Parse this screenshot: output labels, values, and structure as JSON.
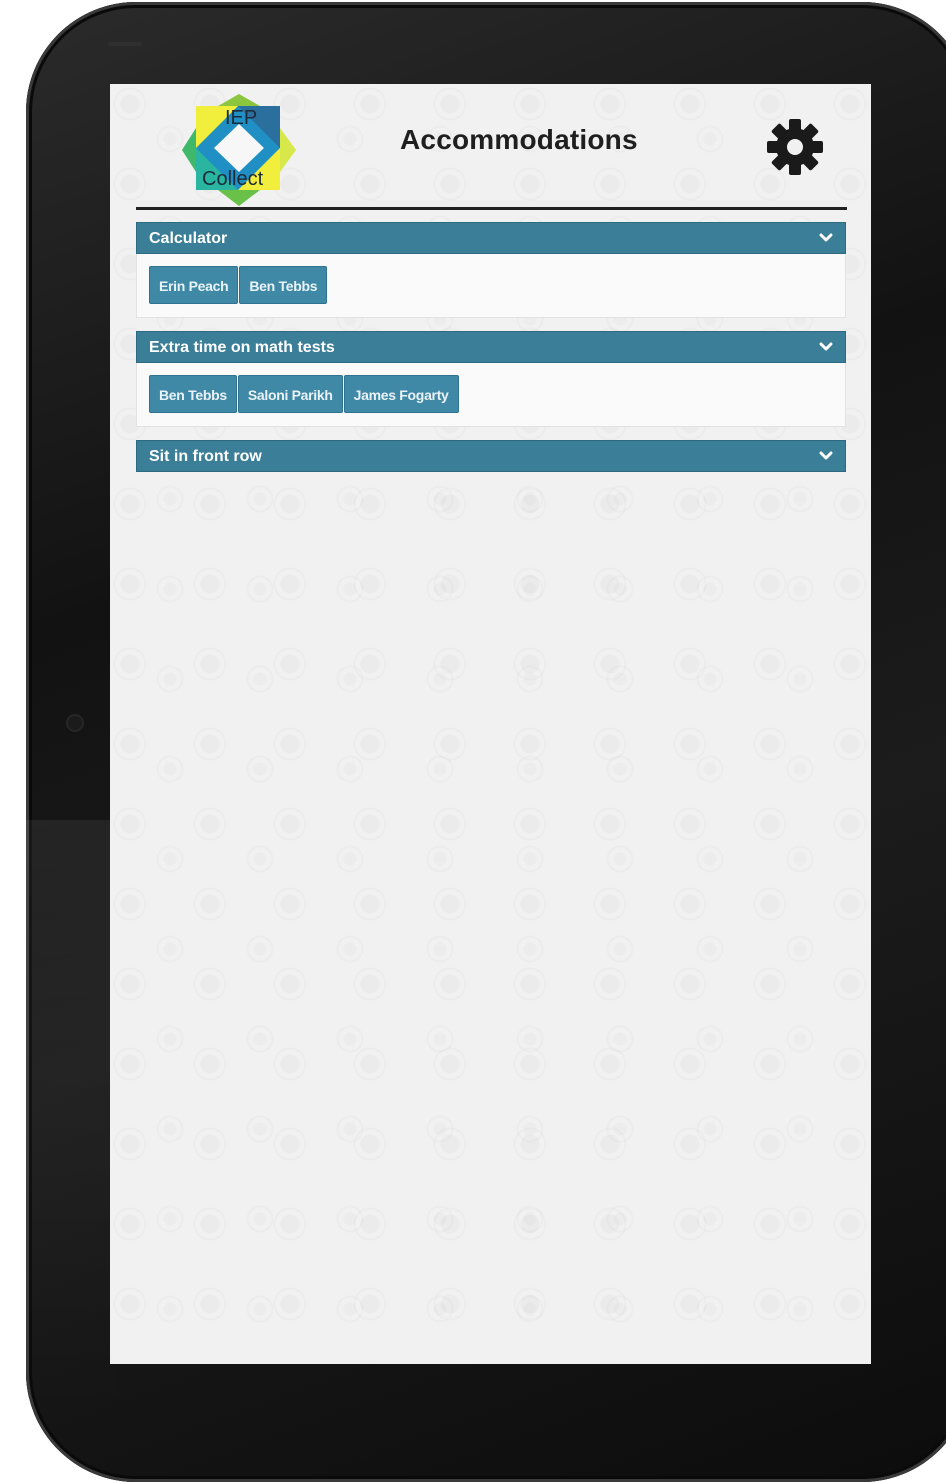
{
  "app": {
    "title": "Accommodations",
    "logo": {
      "line1": "IEP",
      "line2": "Collect"
    }
  },
  "colors": {
    "accent": "#3b7e98",
    "chip": "#3f88a6",
    "screen_bg": "#f1f1f1",
    "bezel": "#141414"
  },
  "icons": {
    "settings": "gear-icon",
    "expand": "chevron-down-icon"
  },
  "accommodations": [
    {
      "label": "Calculator",
      "students": [
        "Erin Peach",
        "Ben Tebbs"
      ]
    },
    {
      "label": "Extra time on math tests",
      "students": [
        "Ben Tebbs",
        "Saloni Parikh",
        "James Fogarty"
      ]
    },
    {
      "label": "Sit in front row",
      "students": []
    }
  ]
}
